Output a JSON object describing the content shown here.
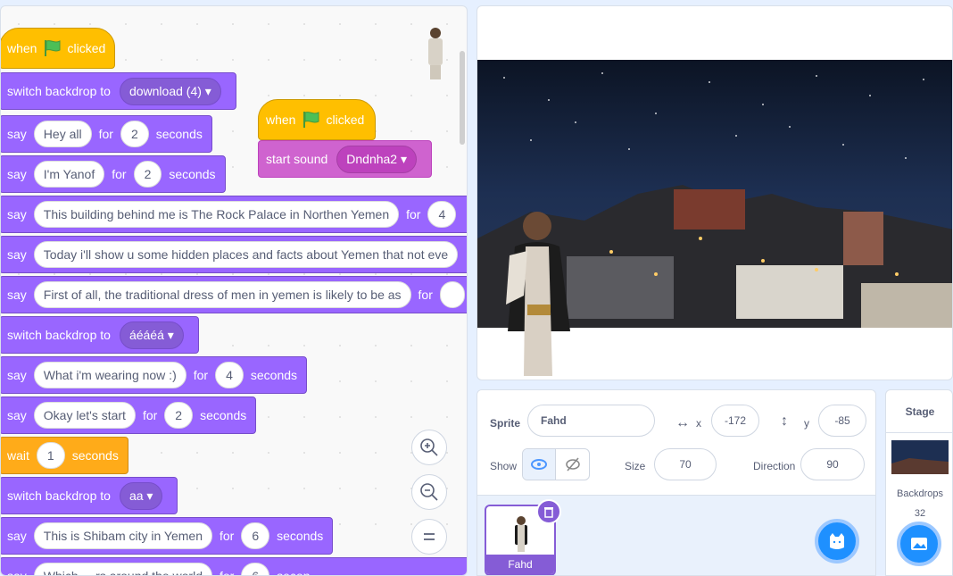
{
  "code": {
    "script1": {
      "hat": {
        "when": "when",
        "clicked": "clicked"
      },
      "blocks": [
        {
          "type": "backdrop",
          "label": "switch backdrop to",
          "value": "download (4)"
        },
        {
          "type": "say_for",
          "label": "say",
          "text": "Hey all",
          "for": "for",
          "secs": "2",
          "unit": "seconds"
        },
        {
          "type": "say_for",
          "label": "say",
          "text": "I'm Yanof",
          "for": "for",
          "secs": "2",
          "unit": "seconds"
        },
        {
          "type": "say_for",
          "label": "say",
          "text": "This building behind me is The Rock Palace in Northen Yemen",
          "for": "for",
          "secs": "4"
        },
        {
          "type": "say",
          "label": "say",
          "text": "Today i'll show u some hidden places and facts about Yemen that not eve"
        },
        {
          "type": "say_for",
          "label": "say",
          "text": "First of all, the traditional dress of men in yemen is likely to be as",
          "for": "for"
        },
        {
          "type": "backdrop",
          "label": "switch backdrop to",
          "value": "áéáéá"
        },
        {
          "type": "say_for",
          "label": "say",
          "text": "What i'm wearing now :)",
          "for": "for",
          "secs": "4",
          "unit": "seconds"
        },
        {
          "type": "say_for",
          "label": "say",
          "text": "Okay let's start",
          "for": "for",
          "secs": "2",
          "unit": "seconds"
        },
        {
          "type": "wait",
          "label": "wait",
          "secs": "1",
          "unit": "seconds"
        },
        {
          "type": "backdrop",
          "label": "switch backdrop to",
          "value": "aa"
        },
        {
          "type": "say_for",
          "label": "say",
          "text": "This is Shibam city in Yemen",
          "for": "for",
          "secs": "6",
          "unit": "seconds"
        },
        {
          "type": "say_for",
          "label": "say",
          "text": "Which ... rs around the world",
          "for": "for",
          "secs": "6",
          "unit": "secon"
        }
      ]
    },
    "script2": {
      "hat": {
        "when": "when",
        "clicked": "clicked"
      },
      "sound": {
        "label": "start sound",
        "value": "Dndnha2"
      }
    },
    "zoom": {
      "in_icon": "zoom-in",
      "out_icon": "zoom-out",
      "reset_icon": "zoom-reset"
    }
  },
  "sprite_info": {
    "sprite_label": "Sprite",
    "sprite_name": "Fahd",
    "x_label": "x",
    "x_value": "-172",
    "y_label": "y",
    "y_value": "-85",
    "show_label": "Show",
    "size_label": "Size",
    "size_value": "70",
    "direction_label": "Direction",
    "direction_value": "90"
  },
  "sprite_list": [
    {
      "name": "Fahd"
    }
  ],
  "stage_pane": {
    "title": "Stage",
    "backdrops_label": "Backdrops",
    "backdrops_count": "32"
  },
  "colors": {
    "looks": "#9966ff",
    "events": "#ffbf00",
    "control": "#ffab19",
    "sound": "#cf63cf",
    "accent": "#855cd6"
  }
}
